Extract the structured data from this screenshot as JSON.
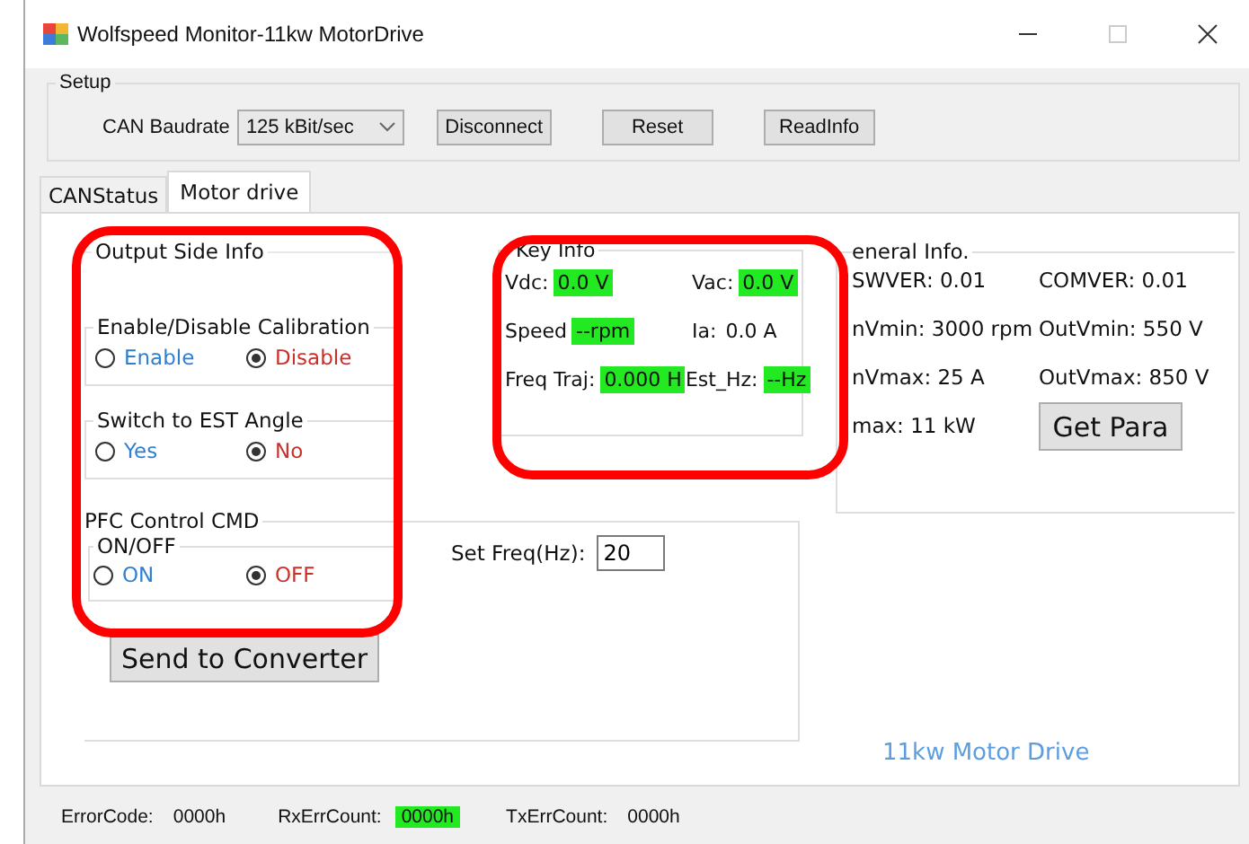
{
  "window": {
    "title": "Wolfspeed Monitor-11kw MotorDrive"
  },
  "setup": {
    "title": "Setup",
    "baudrate_label": "CAN Baudrate",
    "baudrate": "125 kBit/sec",
    "buttons": [
      "Disconnect",
      "Reset",
      "ReadInfo"
    ]
  },
  "tabs": [
    {
      "label": "CANStatus",
      "selected": false
    },
    {
      "label": "Motor drive",
      "selected": true
    }
  ],
  "output_side": {
    "title": "Output Side Info",
    "highlighted": true,
    "groups": [
      {
        "title": "Enable/Disable Calibration",
        "options": [
          {
            "label": "Enable",
            "selected": false
          },
          {
            "label": "Disable",
            "selected": true
          }
        ]
      },
      {
        "title": "Switch to EST Angle",
        "options": [
          {
            "label": "Yes",
            "selected": false
          },
          {
            "label": "No",
            "selected": true
          }
        ]
      }
    ]
  },
  "pfc": {
    "title": "PFC Control CMD",
    "group": {
      "title": "ON/OFF",
      "options": [
        {
          "label": "ON",
          "selected": false
        },
        {
          "label": "OFF",
          "selected": true
        }
      ]
    },
    "freq_label": "Set Freq(Hz):",
    "freq_value": "20",
    "send_button": "Send to Converter"
  },
  "key_info": {
    "title": "Key Info",
    "highlighted": true,
    "rows": [
      [
        {
          "label": "Vdc:",
          "value": "0.0 V",
          "highlighted": true
        },
        {
          "label": "Vac:",
          "value": "0.0 V",
          "highlighted": true
        }
      ],
      [
        {
          "label": "Speed",
          "value": "--rpm",
          "highlighted": true
        },
        {
          "label": "Ia:",
          "value": "0.0 A",
          "highlighted": false
        }
      ],
      [
        {
          "label": "Freq Traj:",
          "value": "0.000 H",
          "highlighted": true
        },
        {
          "label": "Est_Hz:",
          "value": "--Hz",
          "highlighted": true
        }
      ]
    ]
  },
  "general_info": {
    "title": "eneral Info.",
    "items": [
      "SWVER: 0.01",
      "COMVER: 0.01",
      "nVmin: 3000 rpm",
      "OutVmin: 550 V",
      "nVmax: 25 A",
      "OutVmax: 850 V",
      "max: 11 kW"
    ],
    "button": "Get Para"
  },
  "footer_label": "11kw Motor Drive",
  "status_bar": [
    {
      "label": "ErrorCode:",
      "value": "0000h",
      "highlighted": false
    },
    {
      "label": "RxErrCount:",
      "value": "0000h",
      "highlighted": true
    },
    {
      "label": "TxErrCount:",
      "value": "0000h",
      "highlighted": false
    }
  ]
}
